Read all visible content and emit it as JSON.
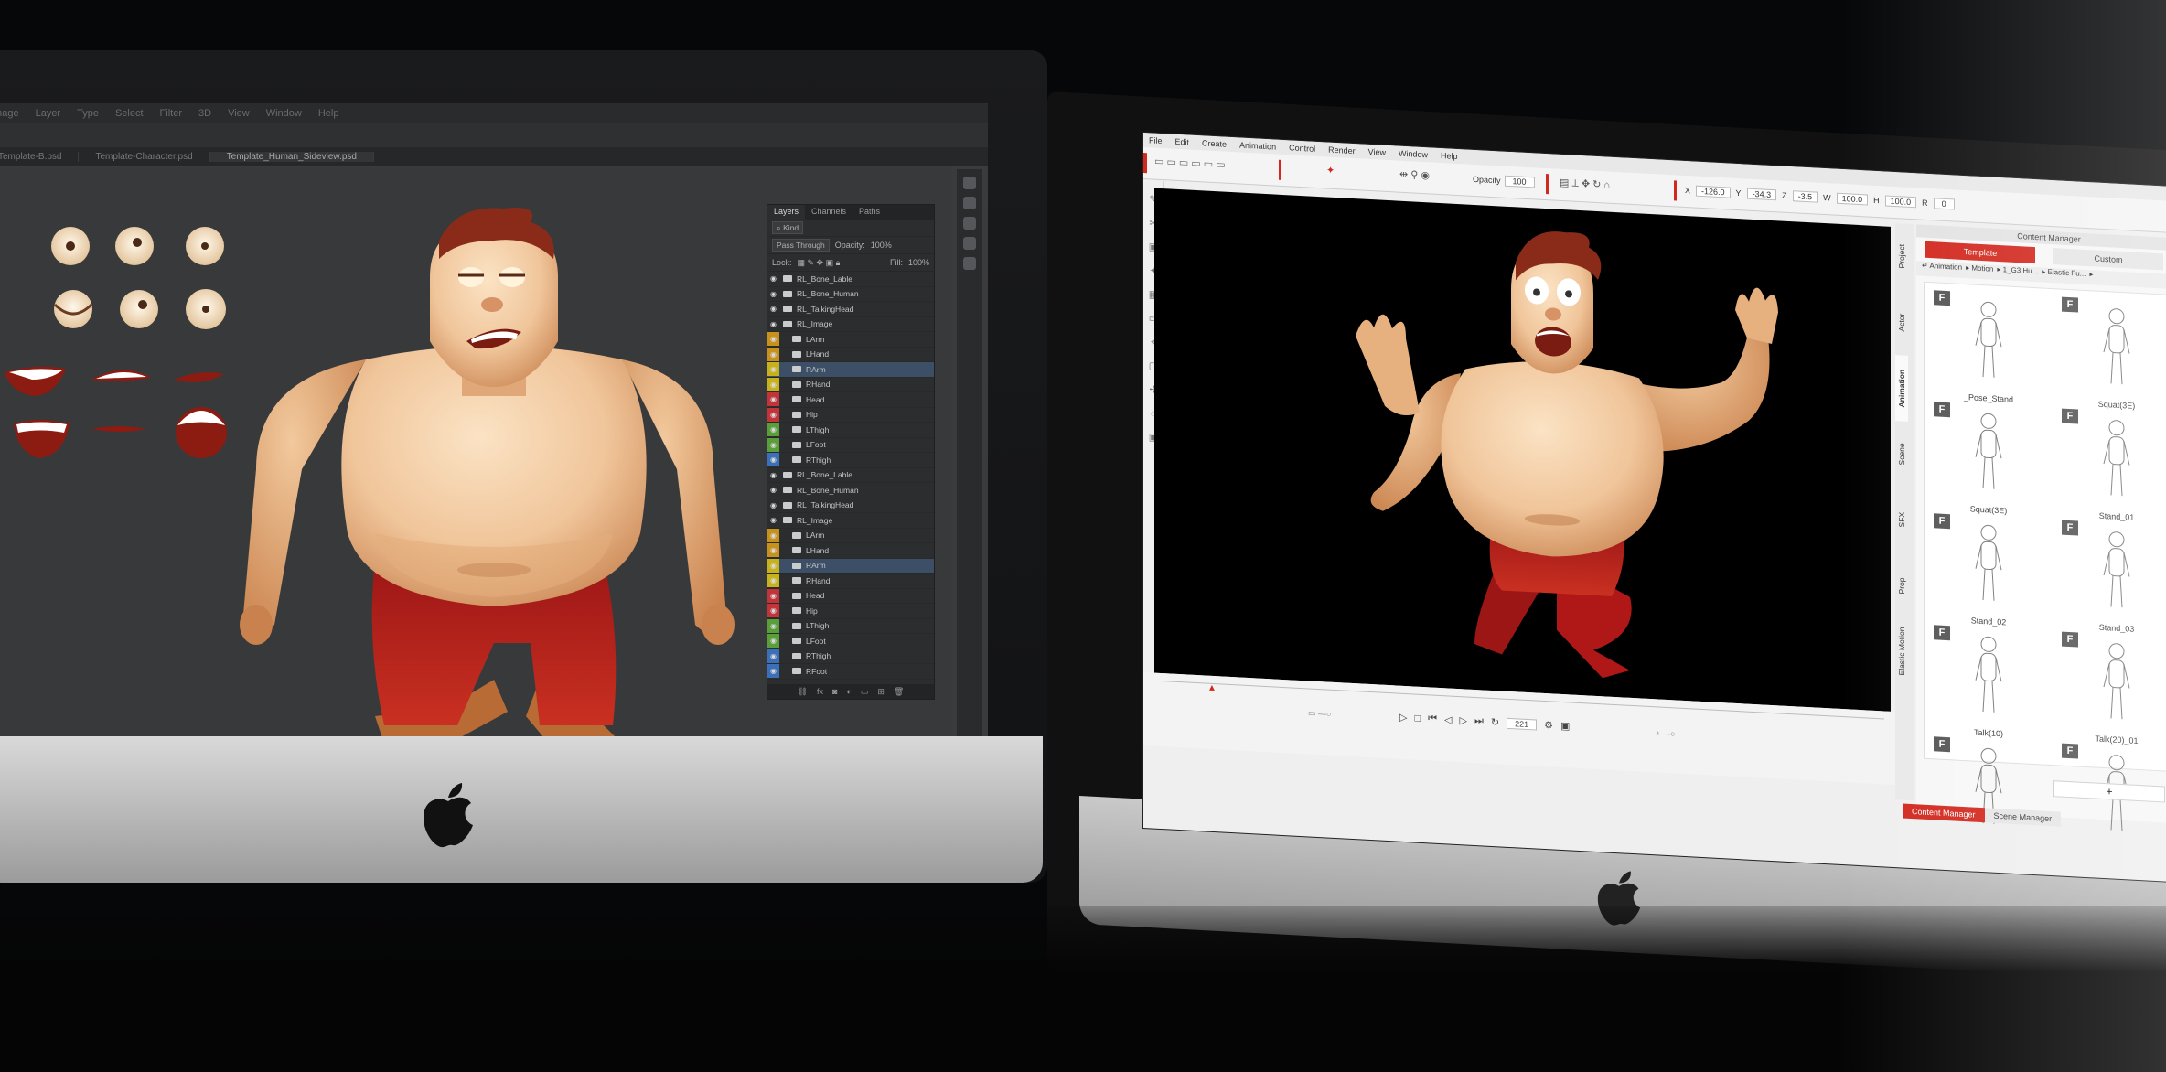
{
  "photoshop": {
    "menu": [
      "Image",
      "Layer",
      "Type",
      "Select",
      "Filter",
      "3D",
      "View",
      "Window",
      "Help"
    ],
    "tabs": [
      {
        "label": "Template-B.psd",
        "active": false
      },
      {
        "label": "Template-Character.psd",
        "active": false
      },
      {
        "label": "Template_Human_Sideview.psd",
        "active": true
      }
    ],
    "layers_panel": {
      "tabs": [
        "Layers",
        "Channels",
        "Paths"
      ],
      "filter_label": "Kind",
      "blend_mode": "Pass Through",
      "opacity_label": "Opacity:",
      "opacity_value": "100%",
      "lock_label": "Lock:",
      "fill_label": "Fill:",
      "fill_value": "100%",
      "layers": [
        {
          "name": "RL_Bone_Lable",
          "color": "",
          "indent": false,
          "selected": false
        },
        {
          "name": "RL_Bone_Human",
          "color": "",
          "indent": false,
          "selected": false
        },
        {
          "name": "RL_TalkingHead",
          "color": "",
          "indent": false,
          "selected": false
        },
        {
          "name": "RL_Image",
          "color": "",
          "indent": false,
          "selected": false
        },
        {
          "name": "LArm",
          "color": "#c7921c",
          "indent": true,
          "selected": false
        },
        {
          "name": "LHand",
          "color": "#c7921c",
          "indent": true,
          "selected": false
        },
        {
          "name": "RArm",
          "color": "#c7b21c",
          "indent": true,
          "selected": true
        },
        {
          "name": "RHand",
          "color": "#c7b21c",
          "indent": true,
          "selected": false
        },
        {
          "name": "Head",
          "color": "#c2343a",
          "indent": true,
          "selected": false
        },
        {
          "name": "Hip",
          "color": "#c2343a",
          "indent": true,
          "selected": false
        },
        {
          "name": "LThigh",
          "color": "#5a9e3a",
          "indent": true,
          "selected": false
        },
        {
          "name": "LFoot",
          "color": "#5a9e3a",
          "indent": true,
          "selected": false
        },
        {
          "name": "RThigh",
          "color": "#3b6fb8",
          "indent": true,
          "selected": false
        },
        {
          "name": "RL_Bone_Lable",
          "color": "",
          "indent": false,
          "selected": false
        },
        {
          "name": "RL_Bone_Human",
          "color": "",
          "indent": false,
          "selected": false
        },
        {
          "name": "RL_TalkingHead",
          "color": "",
          "indent": false,
          "selected": false
        },
        {
          "name": "RL_Image",
          "color": "",
          "indent": false,
          "selected": false
        },
        {
          "name": "LArm",
          "color": "#c7921c",
          "indent": true,
          "selected": false
        },
        {
          "name": "LHand",
          "color": "#c7921c",
          "indent": true,
          "selected": false
        },
        {
          "name": "RArm",
          "color": "#c7b21c",
          "indent": true,
          "selected": true
        },
        {
          "name": "RHand",
          "color": "#c7b21c",
          "indent": true,
          "selected": false
        },
        {
          "name": "Head",
          "color": "#c2343a",
          "indent": true,
          "selected": false
        },
        {
          "name": "Hip",
          "color": "#c2343a",
          "indent": true,
          "selected": false
        },
        {
          "name": "LThigh",
          "color": "#5a9e3a",
          "indent": true,
          "selected": false
        },
        {
          "name": "LFoot",
          "color": "#5a9e3a",
          "indent": true,
          "selected": false
        },
        {
          "name": "RThigh",
          "color": "#3b6fb8",
          "indent": true,
          "selected": false
        },
        {
          "name": "RFoot",
          "color": "#3b6fb8",
          "indent": true,
          "selected": false
        }
      ],
      "footer_icons": [
        "link-icon",
        "fx-icon",
        "mask-icon",
        "adjustment-icon",
        "folder-icon",
        "new-layer-icon",
        "trash-icon"
      ]
    }
  },
  "cartoon_animator": {
    "menu": [
      "File",
      "Edit",
      "Create",
      "Animation",
      "Control",
      "Render",
      "View",
      "Window",
      "Help"
    ],
    "toolbar": {
      "opacity_label": "Opacity",
      "opacity_value": "100",
      "x_label": "X",
      "x_value": "-126.0",
      "y_label": "Y",
      "y_value": "-34.3",
      "z_label": "Z",
      "z_value": "-3.5",
      "w_label": "W",
      "w_value": "100.0",
      "h_label": "H",
      "h_value": "100.0",
      "r_label": "R",
      "r_value": "0"
    },
    "timeline": {
      "frame_value": "221"
    },
    "side_tabs": [
      "Project",
      "Actor",
      "Animation",
      "Scene",
      "SFX",
      "Prop",
      "Elastic Motion"
    ],
    "active_side_tab": "Animation",
    "content_manager": {
      "title": "Content Manager",
      "tabs": [
        "Template",
        "Custom"
      ],
      "active_tab": "Template",
      "path": [
        "Animation",
        "Motion",
        "1_G3 Hu...",
        "Elastic Fu..."
      ],
      "items": [
        {
          "label": "_Pose_Stand",
          "badge": "F"
        },
        {
          "label": "Squat(3E)",
          "badge": "F"
        },
        {
          "label": "Squat(3E)",
          "badge": "F"
        },
        {
          "label": "Stand_01",
          "badge": "F"
        },
        {
          "label": "Stand_02",
          "badge": "F"
        },
        {
          "label": "Stand_03",
          "badge": "F"
        },
        {
          "label": "Talk(10)",
          "badge": "F"
        },
        {
          "label": "Talk(20)_01",
          "badge": "F"
        },
        {
          "label": "",
          "badge": "F"
        },
        {
          "label": "",
          "badge": "F"
        }
      ],
      "add_label": "+"
    },
    "bottom_tabs": [
      "Content Manager",
      "Scene Manager"
    ],
    "active_bottom_tab": "Content Manager"
  },
  "colors": {
    "accent_red": "#d2291f",
    "ps_panel": "#2c2d2f",
    "ca_stage": "#000000",
    "skin": "#f0c59a",
    "pants": "#b01818",
    "hair": "#8a2b1a"
  }
}
